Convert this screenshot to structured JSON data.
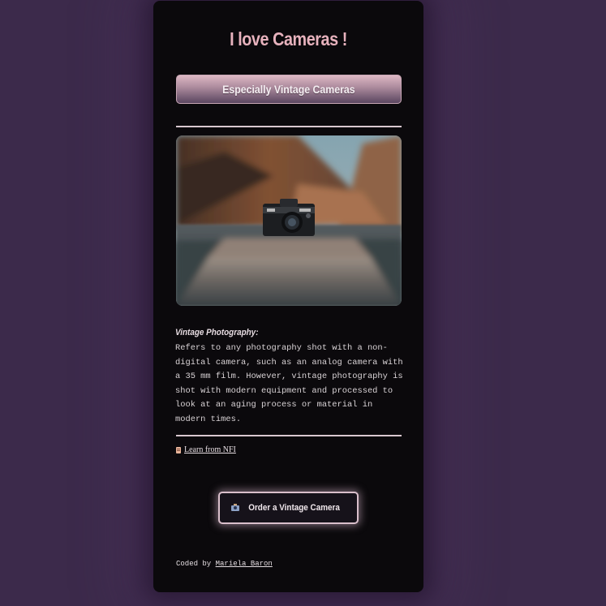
{
  "page": {
    "title": "I love Cameras !",
    "subtitle_button": "Especially Vintage Cameras"
  },
  "photo": {
    "icon": "vintage-camera-photo"
  },
  "article": {
    "heading": "Vintage Photography:",
    "body": "Refers to any photography shot with a non-digital camera, such as an analog camera with a 35 mm film. However, vintage photography is shot with modern equipment and processed to look at an aging process or material in modern times."
  },
  "learn_link": {
    "icon": "document-icon",
    "label": "Learn from NFI"
  },
  "order_button": {
    "icon": "camera-icon",
    "label": "Order a Vintage Camera"
  },
  "footer": {
    "prefix": "Coded by",
    "author": "Mariela Baron"
  },
  "colors": {
    "background": "#3c2a4b",
    "card": "#0b090c",
    "accent": "#e7b2bd"
  }
}
